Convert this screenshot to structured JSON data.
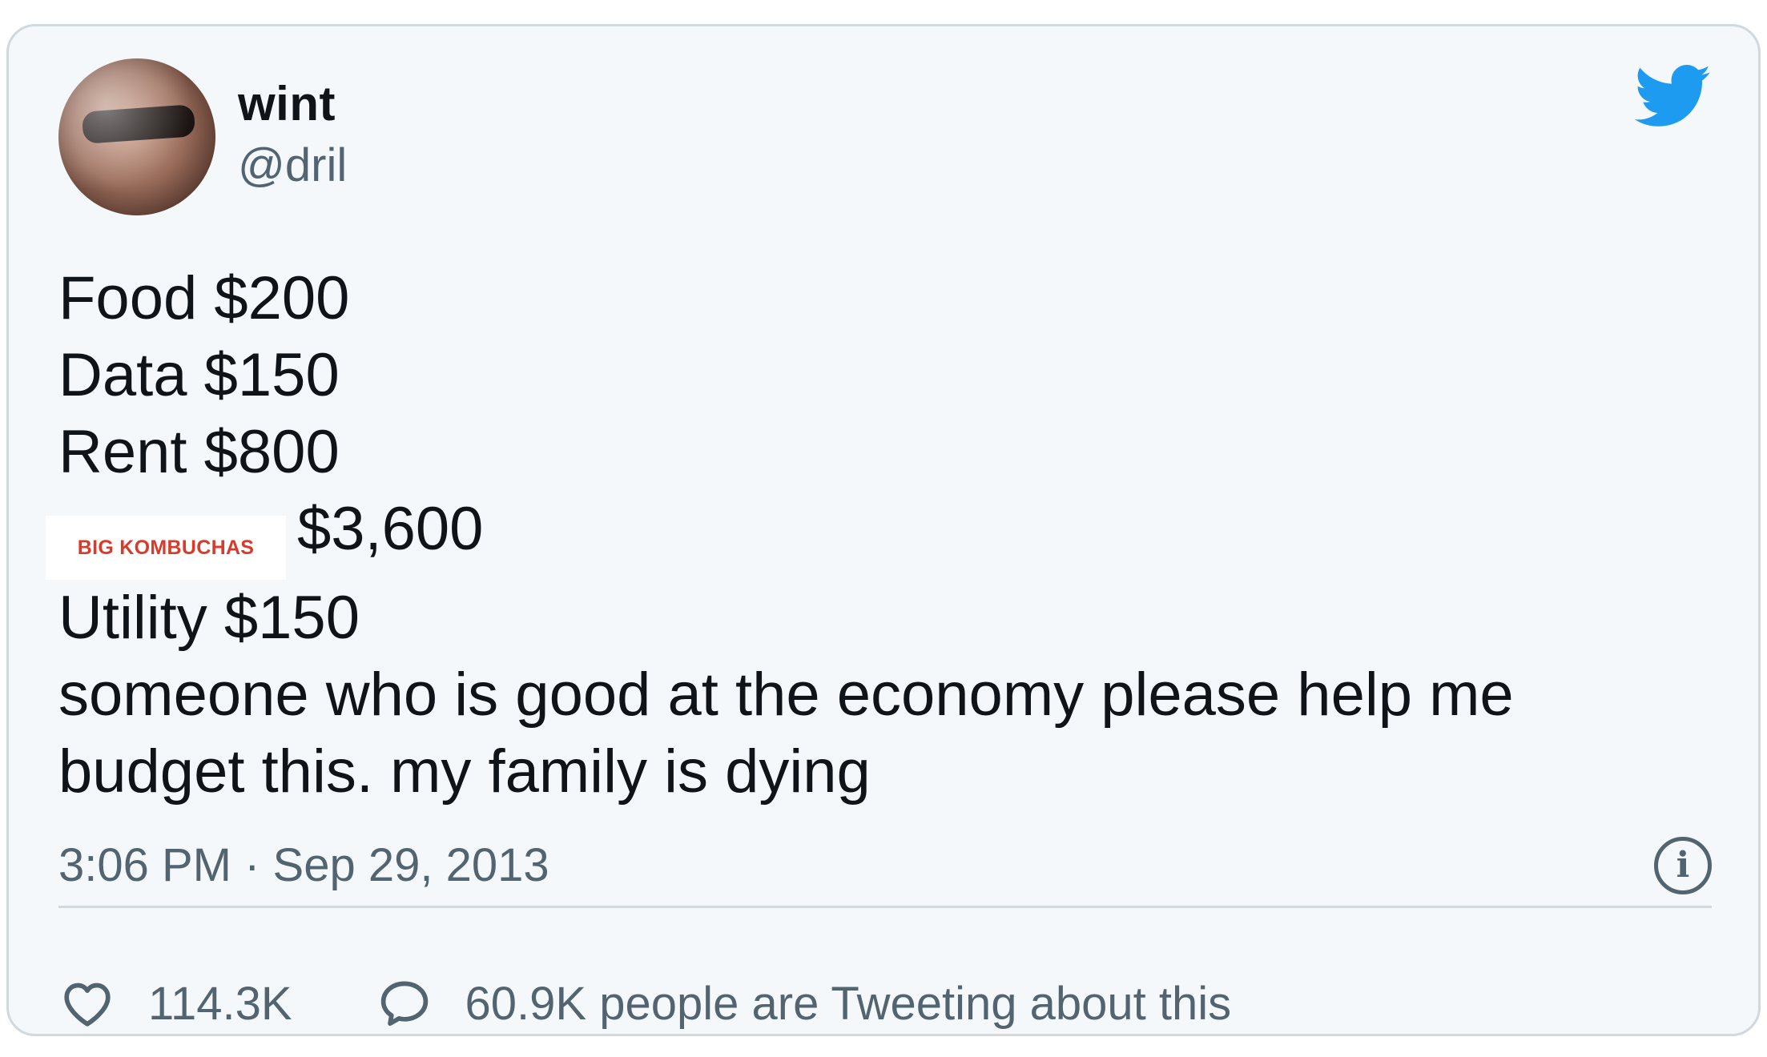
{
  "tweet": {
    "display_name": "wint",
    "handle": "@dril",
    "lines": [
      "Food $200",
      "Data $150",
      "Rent $800",
      "$3,600",
      "Utility $150",
      "someone who is good at the economy please help me",
      "budget this. my family is dying"
    ],
    "censor_label": "BIG KOMBUCHAS",
    "timestamp": "3:06 PM · Sep 29, 2013",
    "likes": "114.3K",
    "conversation_text": "60.9K people are Tweeting about this"
  },
  "icons": {
    "brand": "twitter-bird-icon",
    "info": "info-icon",
    "like": "heart-icon",
    "conversation": "speech-bubble-icon"
  },
  "colors": {
    "card_background": "#f5f8fa",
    "card_border": "#cfd9de",
    "text_primary": "#0f1419",
    "text_secondary": "#536471",
    "brand_blue": "#1d9bf0",
    "censor_text": "#d93a2b"
  }
}
